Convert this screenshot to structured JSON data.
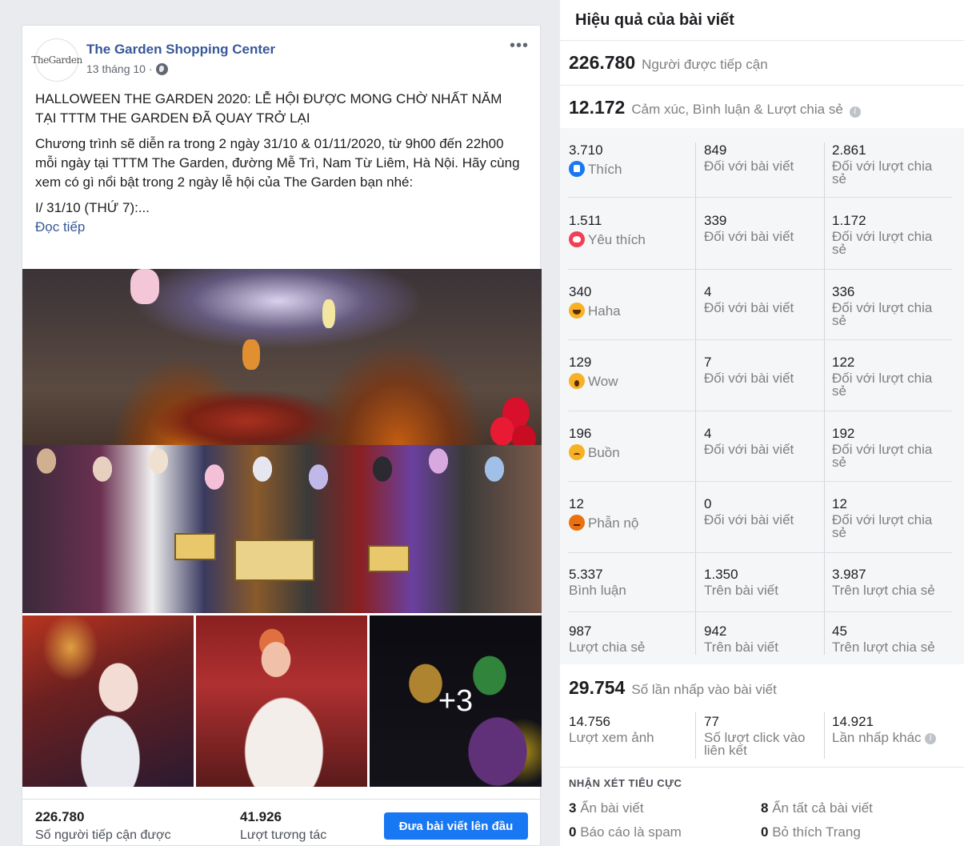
{
  "post": {
    "avatar_text": "TheGarden",
    "page_name": "The Garden Shopping Center",
    "date": "13 tháng 10 ·",
    "heading": "HALLOWEEN THE GARDEN 2020: LỄ HỘI ĐƯỢC MONG CHỜ NHẤT NĂM TẠI TTTM THE GARDEN ĐÃ QUAY TRỞ LẠI",
    "body": "Chương trình sẽ diễn ra trong 2 ngày 31/10 & 01/11/2020, từ 9h00 đến 22h00 mỗi ngày tại TTTM The Garden, đường Mễ Trì, Nam Từ Liêm, Hà Nội. Hãy cùng xem có gì nổi bật trong 2 ngày lễ hội của The Garden bạn nhé:",
    "day_line": "I/ 31/10 (THỨ 7):...",
    "read_more": "Đọc tiếp",
    "more_photos": "+3",
    "more_menu": "•••",
    "reach_num": "226.780",
    "reach_lbl": "Số người tiếp cận được",
    "engage_num": "41.926",
    "engage_lbl": "Lượt tương tác",
    "boost_btn": "Đưa bài viết lên đầu"
  },
  "panel": {
    "title": "Hiệu quả của bài viết",
    "reach": {
      "num": "226.780",
      "label": "Người được tiếp cận"
    },
    "reactions_total": {
      "num": "12.172",
      "label": "Cảm xúc, Bình luận & Lượt chia sẻ"
    },
    "reactions": [
      {
        "icon": "like-icon",
        "total": "3.710",
        "name": "Thích",
        "on_post": "849",
        "on_shares": "2.861"
      },
      {
        "icon": "love-icon",
        "total": "1.511",
        "name": "Yêu thích",
        "on_post": "339",
        "on_shares": "1.172"
      },
      {
        "icon": "haha-icon",
        "total": "340",
        "name": "Haha",
        "on_post": "4",
        "on_shares": "336"
      },
      {
        "icon": "wow-icon",
        "total": "129",
        "name": "Wow",
        "on_post": "7",
        "on_shares": "122"
      },
      {
        "icon": "sad-icon",
        "total": "196",
        "name": "Buồn",
        "on_post": "4",
        "on_shares": "192"
      },
      {
        "icon": "angry-icon",
        "total": "12",
        "name": "Phẫn nộ",
        "on_post": "0",
        "on_shares": "12"
      }
    ],
    "on_post_label": "Đối với bài viết",
    "on_shares_label_1": "Đối với lượt chia",
    "on_shares_label_2": "sẻ",
    "comments": {
      "total": "5.337",
      "label": "Bình luận",
      "on_post": "1.350",
      "on_post_label": "Trên bài viết",
      "on_shares": "3.987",
      "on_shares_label": "Trên lượt chia sẻ"
    },
    "shares": {
      "total": "987",
      "label": "Lượt chia sẻ",
      "on_post": "942",
      "on_post_label": "Trên bài viết",
      "on_shares": "45",
      "on_shares_label": "Trên lượt chia sẻ"
    },
    "clicks_total": {
      "num": "29.754",
      "label": "Số lần nhấp vào bài viết"
    },
    "clicks": {
      "photo_views": "14.756",
      "photo_views_label": "Lượt xem ảnh",
      "link_clicks": "77",
      "link_clicks_label_1": "Số lượt click vào",
      "link_clicks_label_2": "liên kết",
      "other_clicks": "14.921",
      "other_clicks_label": "Lần nhấp khác"
    },
    "negative": {
      "title": "NHẬN XÉT TIÊU CỰC",
      "hide_post_num": "3",
      "hide_post": "Ẩn bài viết",
      "hide_all_num": "8",
      "hide_all": "Ẩn tất cả bài viết",
      "spam_num": "0",
      "spam": "Báo cáo là spam",
      "unlike_num": "0",
      "unlike": "Bỏ thích Trang"
    }
  },
  "colors": {
    "link": "#385898",
    "primary": "#1877f2",
    "muted": "#7f7f7f"
  }
}
